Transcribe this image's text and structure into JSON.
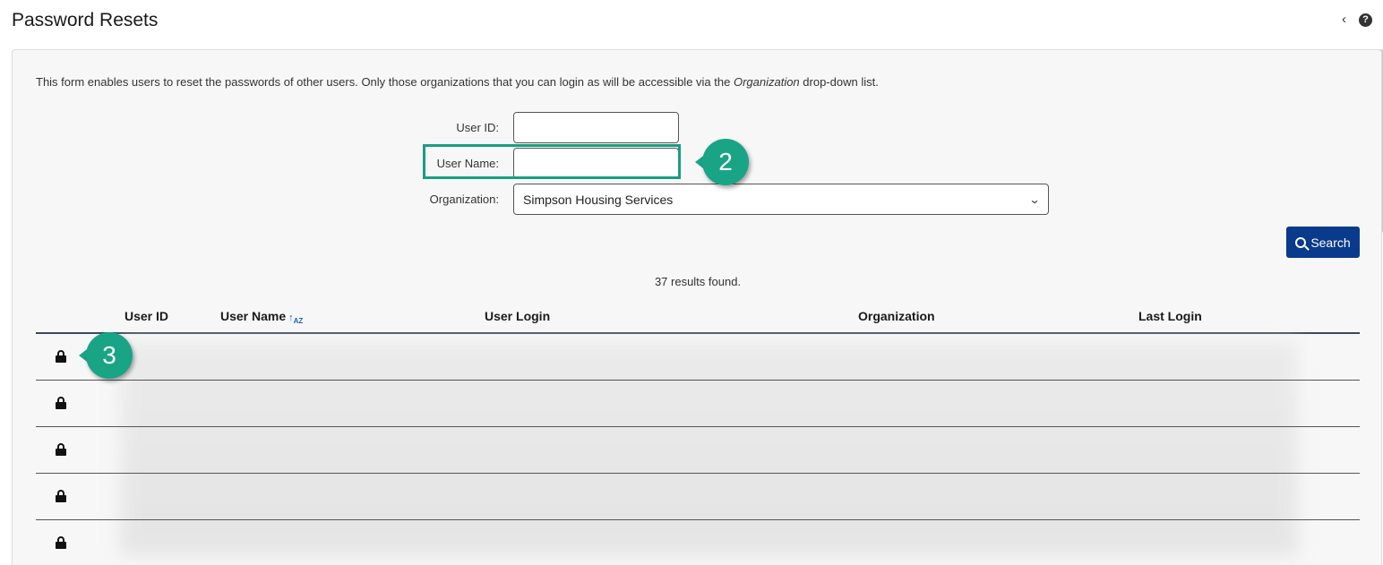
{
  "header": {
    "title": "Password Resets",
    "collapse_glyph": "‹",
    "help_glyph": "?"
  },
  "form": {
    "intro_before": "This form enables users to reset the passwords of other users. Only those organizations that you can login as will be accessible via the ",
    "intro_em": "Organization",
    "intro_after": " drop-down list.",
    "user_id_label": "User ID:",
    "user_id_value": "",
    "user_name_label": "User Name:",
    "user_name_value": "",
    "organization_label": "Organization:",
    "organization_selected": "Simpson Housing Services",
    "search_label": "Search"
  },
  "results": {
    "count_text": "37 results found."
  },
  "table": {
    "columns": [
      "User ID",
      "User Name",
      "User Login",
      "Organization",
      "Last Login"
    ],
    "sort_glyph": "↑A↓Z",
    "rows": 5
  },
  "callouts": [
    {
      "number": "2"
    },
    {
      "number": "3"
    }
  ],
  "colors": {
    "accent": "#1aa486",
    "button": "#0a3a8c",
    "highlight": "#1a9e82"
  },
  "icons": {
    "search": "search-icon",
    "lock": "lock-icon",
    "help": "help-icon",
    "collapse": "chevron-left-icon",
    "sort": "sort-alpha-icon"
  }
}
